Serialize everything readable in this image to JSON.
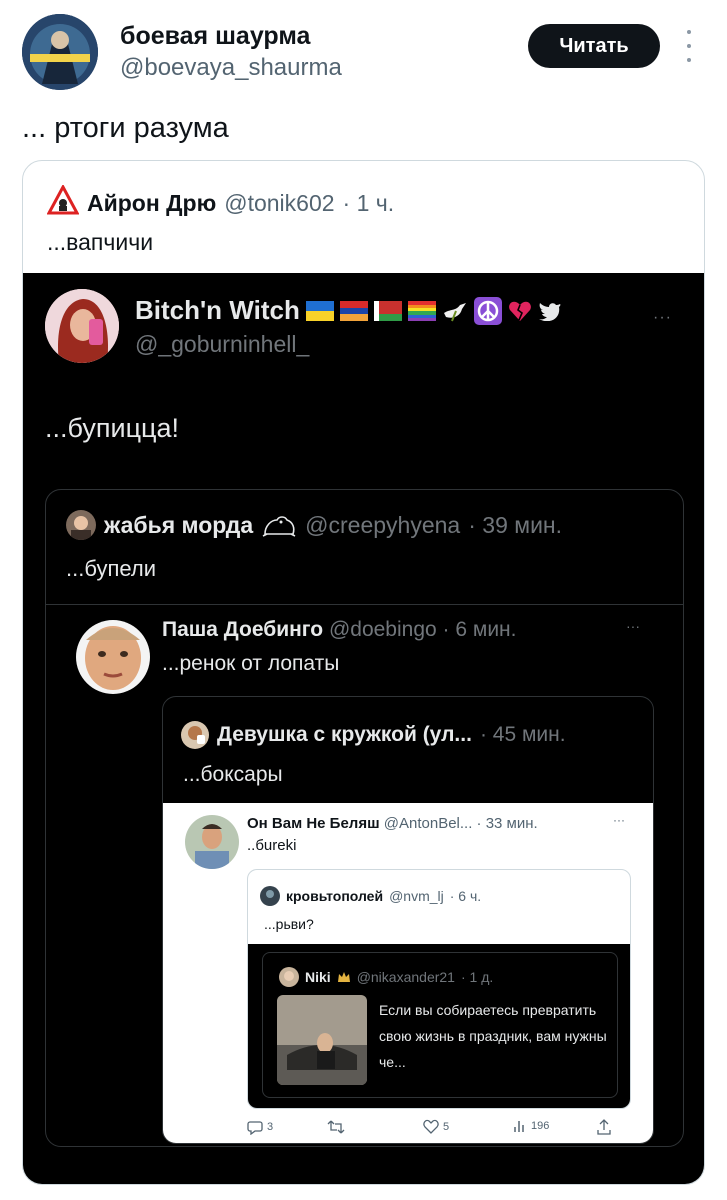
{
  "tweet": {
    "author_name": "боевая шаурма",
    "author_handle": "@boevaya_shaurma",
    "follow_label": "Читать",
    "text": "... ртоги разума"
  },
  "quote1": {
    "author_name": "Айрон Дрю",
    "author_handle": "@tonik602",
    "time": "· 1 ч.",
    "text": "...вапчичи"
  },
  "screenshot_tweet": {
    "author_name": "Bitch'n Witch",
    "author_handle": "@_goburninhell_",
    "more": "···",
    "text": "...бупицца!"
  },
  "quote2": {
    "author_name": "жабья морда",
    "author_handle": "@creepyhyena",
    "time": "· 39 мин.",
    "text": "...бупели"
  },
  "reply_pasha": {
    "author_name": "Паша Доебинго",
    "author_handle": "@doebingo",
    "time": "· 6 мин.",
    "more": "···",
    "text": "...ренок от лопаты"
  },
  "quote3": {
    "author_name": "Девушка с кружкой (ул...",
    "time": "· 45 мин.",
    "text": "...боксары"
  },
  "light_tweet": {
    "author_name": "Он Вам Не Беляш",
    "author_handle": "@AntonBel...",
    "time": "· 33 мин.",
    "more": "···",
    "text": "..бureki"
  },
  "quote4": {
    "author_name": "кровьтополей",
    "author_handle": "@nvm_lj",
    "time": "· 6 ч.",
    "text": "...рьви?"
  },
  "quote5": {
    "author_name": "Niki",
    "author_handle": "@nikaxander21",
    "time": "· 1 д.",
    "text": "Если вы собираетесь превратить свою жизнь в праздник, вам нужны че..."
  },
  "actions": {
    "replies": "3",
    "likes": "5",
    "views": "196"
  },
  "colors": {
    "accent_dark": "#0f1419",
    "secondary_text": "#536471",
    "dark_bg": "#000000",
    "border_light": "#cfd9de",
    "border_dark": "#2f3336"
  }
}
